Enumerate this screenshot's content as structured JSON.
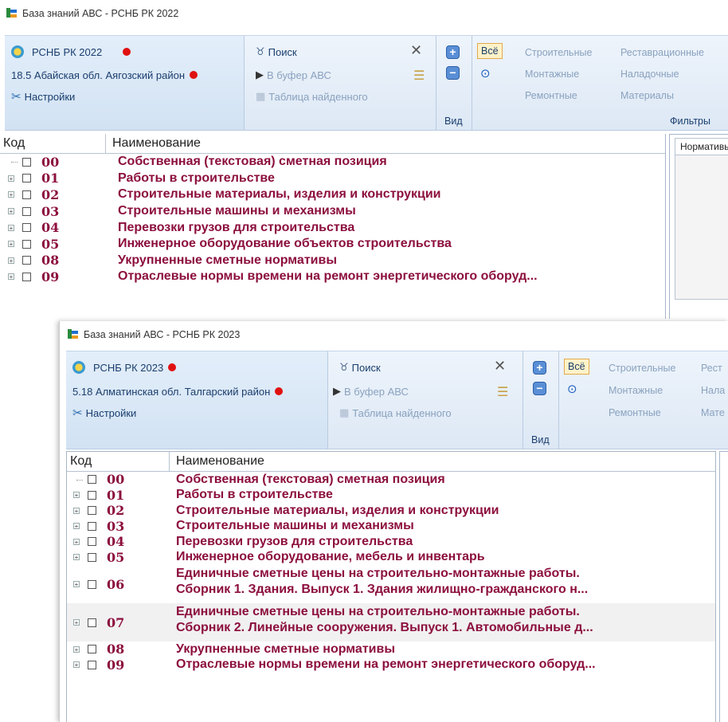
{
  "back": {
    "title": "База знаний АВС -  РСНБ РК 2022",
    "db_name": "РСНБ РК 2022",
    "region": "18.5 Абайская обл. Аягозский район",
    "settings": "Настройки",
    "search": "Поиск",
    "to_buffer": "В буфер АВС",
    "found_table": "Таблица найденного",
    "view_group": "Вид",
    "all": "Всё",
    "filters": [
      "Строительные",
      "Реставрационные",
      "Монтажные",
      "Наладочные",
      "Ремонтные",
      "Материалы"
    ],
    "filters_group": "Фильтры",
    "col_code": "Код",
    "col_name": "Наименование",
    "right_tab": "Нормативы",
    "rows": [
      {
        "code": "00",
        "name": "Собственная (текстовая) сметная позиция"
      },
      {
        "code": "01",
        "name": "Работы в строительстве"
      },
      {
        "code": "02",
        "name": "Строительные материалы, изделия и конструкции"
      },
      {
        "code": "03",
        "name": "Строительные машины и механизмы"
      },
      {
        "code": "04",
        "name": "Перевозки грузов для строительства"
      },
      {
        "code": "05",
        "name": "Инженерное оборудование объектов строительства"
      },
      {
        "code": "08",
        "name": "Укрупненные сметные нормативы"
      },
      {
        "code": "09",
        "name": "Отраслевые нормы времени на ремонт энергетического оборуд..."
      }
    ]
  },
  "front": {
    "title": "База знаний АВС -  РСНБ РК 2023",
    "db_name": "РСНБ РК 2023",
    "region": "5.18 Алматинская обл. Талгарский район",
    "settings": "Настройки",
    "search": "Поиск",
    "to_buffer": "В буфер АВС",
    "found_table": "Таблица найденного",
    "view_group": "Вид",
    "all": "Всё",
    "filters": [
      "Строительные",
      "Рест",
      "Монтажные",
      "Нала",
      "Ремонтные",
      "Мате"
    ],
    "col_code": "Код",
    "col_name": "Наименование",
    "rows": [
      {
        "code": "00",
        "name": "Собственная (текстовая) сметная позиция"
      },
      {
        "code": "01",
        "name": "Работы в строительстве"
      },
      {
        "code": "02",
        "name": "Строительные материалы, изделия и конструкции"
      },
      {
        "code": "03",
        "name": "Строительные машины и механизмы"
      },
      {
        "code": "04",
        "name": "Перевозки грузов для строительства"
      },
      {
        "code": "05",
        "name": "Инженерное оборудование, мебель и инвентарь"
      },
      {
        "code": "06",
        "name": "Единичные сметные цены на строительно-монтажные работы.",
        "name2": "Сборник 1. Здания. Выпуск 1. Здания жилищно-гражданского н..."
      },
      {
        "code": "07",
        "name": "Единичные сметные цены на строительно-монтажные работы.",
        "name2": "Сборник 2. Линейные сооружения. Выпуск 1. Автомобильные д..."
      },
      {
        "code": "08",
        "name": "Укрупненные сметные нормативы"
      },
      {
        "code": "09",
        "name": "Отраслевые нормы времени на ремонт энергетического оборуд..."
      }
    ]
  },
  "colors": {
    "accent_red": "#e01010",
    "item_text": "#8c0f3d",
    "ribbon_text": "#1a3e6e"
  },
  "icons": [
    "app-icon",
    "emblem-icon",
    "settings-tools-icon",
    "binoculars-search-icon",
    "close-x-icon",
    "export-buffer-icon",
    "table-icon",
    "expand-all-icon",
    "collapse-all-icon",
    "eye-icon"
  ]
}
